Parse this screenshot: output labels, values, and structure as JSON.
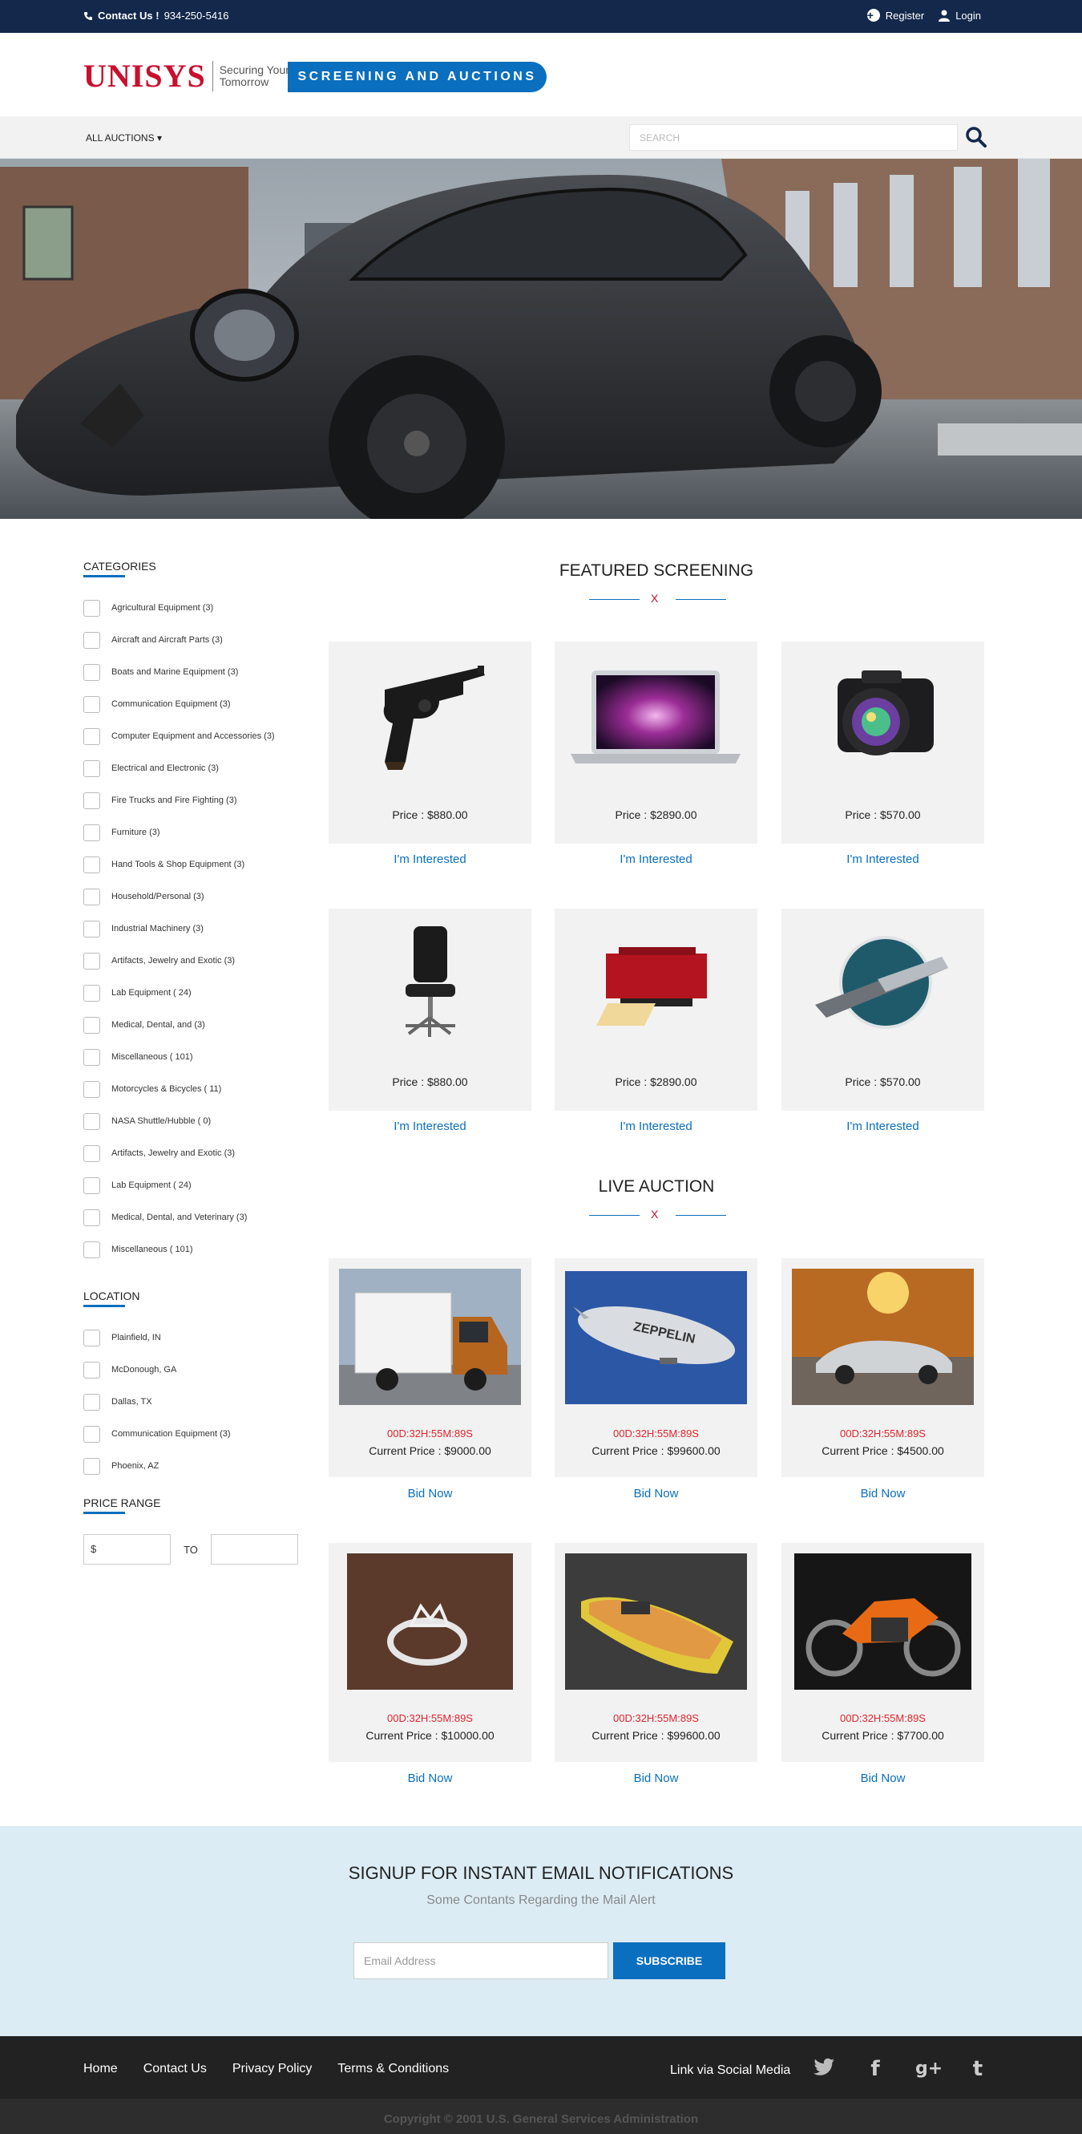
{
  "topbar": {
    "contact_label": "Contact Us !",
    "phone": "934-250-5416",
    "register": "Register",
    "login": "Login"
  },
  "header": {
    "brand": "UNISYS",
    "tagline_1": "Securing Your",
    "tagline_2": "Tomorrow",
    "banner": "SCREENING AND AUCTIONS"
  },
  "nav": {
    "all_auctions": "ALL AUCTIONS",
    "search_placeholder": "SEARCH"
  },
  "sidebar": {
    "categories_title": "CATEGORIES",
    "categories": [
      "Agricultural Equipment (3)",
      "Aircraft and Aircraft Parts (3)",
      "Boats and Marine Equipment (3)",
      "Communication Equipment (3)",
      "Computer Equipment and Accessories (3)",
      "Electrical and Electronic (3)",
      "Fire Trucks and Fire Fighting (3)",
      "Furniture (3)",
      "Hand Tools & Shop Equipment (3)",
      "Household/Personal (3)",
      "Industrial Machinery (3)",
      "Artifacts, Jewelry and Exotic (3)",
      "Lab Equipment ( 24)",
      "Medical, Dental, and (3)",
      "Miscellaneous ( 101)",
      "Motorcycles & Bicycles ( 11)",
      "NASA Shuttle/Hubble ( 0)",
      "Artifacts, Jewelry and Exotic (3)",
      "Lab Equipment ( 24)",
      "Medical, Dental, and Veterinary (3)",
      "Miscellaneous ( 101)"
    ],
    "location_title": "LOCATION",
    "locations": [
      "Plainfield, IN",
      "McDonough, GA",
      "Dallas, TX",
      "Communication Equipment (3)",
      "Phoenix, AZ"
    ],
    "price_title": "PRICE RANGE",
    "price_from": "$",
    "price_to_label": "TO"
  },
  "featured": {
    "title": "FEATURED SCREENING",
    "deco": "X",
    "cta": "I'm Interested",
    "items": [
      {
        "price": "Price : $880.00",
        "icon": "revolver"
      },
      {
        "price": "Price : $2890.00",
        "icon": "laptop"
      },
      {
        "price": "Price : $570.00",
        "icon": "camera"
      },
      {
        "price": "Price : $880.00",
        "icon": "office-chair"
      },
      {
        "price": "Price : $2890.00",
        "icon": "printer"
      },
      {
        "price": "Price : $570.00",
        "icon": "pocket-knife"
      }
    ]
  },
  "live": {
    "title": "LIVE AUCTION",
    "deco": "X",
    "cta": "Bid Now",
    "items": [
      {
        "timer": "00D:32H:55M:89S",
        "price": "Current Price : $9000.00",
        "icon": "truck"
      },
      {
        "timer": "00D:32H:55M:89S",
        "price": "Current Price : $99600.00",
        "icon": "zeppelin",
        "label": "ZEPPELIN"
      },
      {
        "timer": "00D:32H:55M:89S",
        "price": "Current Price : $4500.00",
        "icon": "classic-car"
      },
      {
        "timer": "00D:32H:55M:89S",
        "price": "Current Price : $10000.00",
        "icon": "ring"
      },
      {
        "timer": "00D:32H:55M:89S",
        "price": "Current Price : $99600.00",
        "icon": "boat"
      },
      {
        "timer": "00D:32H:55M:89S",
        "price": "Current Price : $7700.00",
        "icon": "motorcycle"
      }
    ]
  },
  "signup": {
    "title": "SIGNUP FOR INSTANT EMAIL NOTIFICATIONS",
    "subtitle": "Some Contants Regarding the Mail Alert",
    "email_placeholder": "Email Address",
    "button": "SUBSCRIBE"
  },
  "footer": {
    "links": [
      "Home",
      "Contact Us",
      "Privacy Policy",
      "Terms & Conditions"
    ],
    "social_label": "Link via Social Media",
    "social_icons": [
      "twitter-icon",
      "facebook-icon",
      "google-plus-icon",
      "tumblr-icon"
    ],
    "copyright": "Copyright © 2001 U.S. General Services Administration"
  },
  "colors": {
    "navy": "#13284b",
    "accent": "#0a6fbf",
    "brand_red": "#c8102e",
    "timer_red": "#e0242a"
  }
}
